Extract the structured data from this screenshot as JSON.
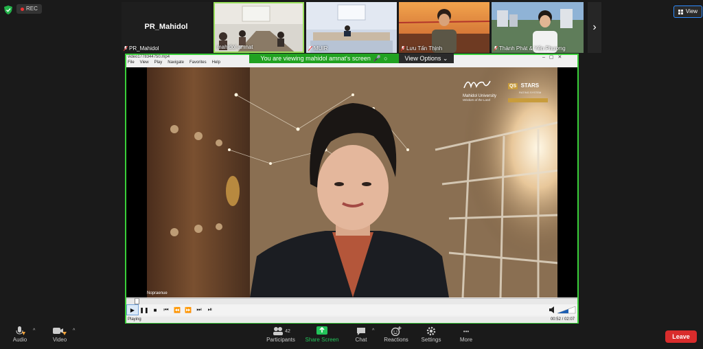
{
  "topbar": {
    "rec_label": "REC",
    "view_label": "View"
  },
  "participants": [
    {
      "name": "PR_Mahidol",
      "display": "PR_Mahidol"
    },
    {
      "name": "mahidol amnat"
    },
    {
      "name": "MUIR"
    },
    {
      "name": "Lưu Tấn Thịnh"
    },
    {
      "name": "Thành Phát & Yến Phương"
    }
  ],
  "share": {
    "banner_text": "You are viewing mahidol amnat's screen",
    "view_options_label": "View Options",
    "window_title": "video1778344750.mp4",
    "menu": [
      "File",
      "View",
      "Play",
      "Navigate",
      "Favorites",
      "Help"
    ],
    "logo_text": "Mahidol University",
    "logo_tagline": "Wisdom of the Land",
    "qs_label": "QS",
    "stars_label": "STARS",
    "stars_sub": "RATING SYSTEM",
    "caption": "Nopraenue",
    "status_left": "Playing",
    "time": "00:52 / 02:07"
  },
  "toolbar": {
    "audio_label": "Audio",
    "video_label": "Video",
    "participants_label": "Participants",
    "participants_count": "42",
    "share_label": "Share Screen",
    "chat_label": "Chat",
    "reactions_label": "Reactions",
    "settings_label": "Settings",
    "more_label": "More",
    "leave_label": "Leave"
  },
  "colors": {
    "accent_green": "#21a221",
    "leave_red": "#d92c2c",
    "share_border": "#3ad03a"
  }
}
